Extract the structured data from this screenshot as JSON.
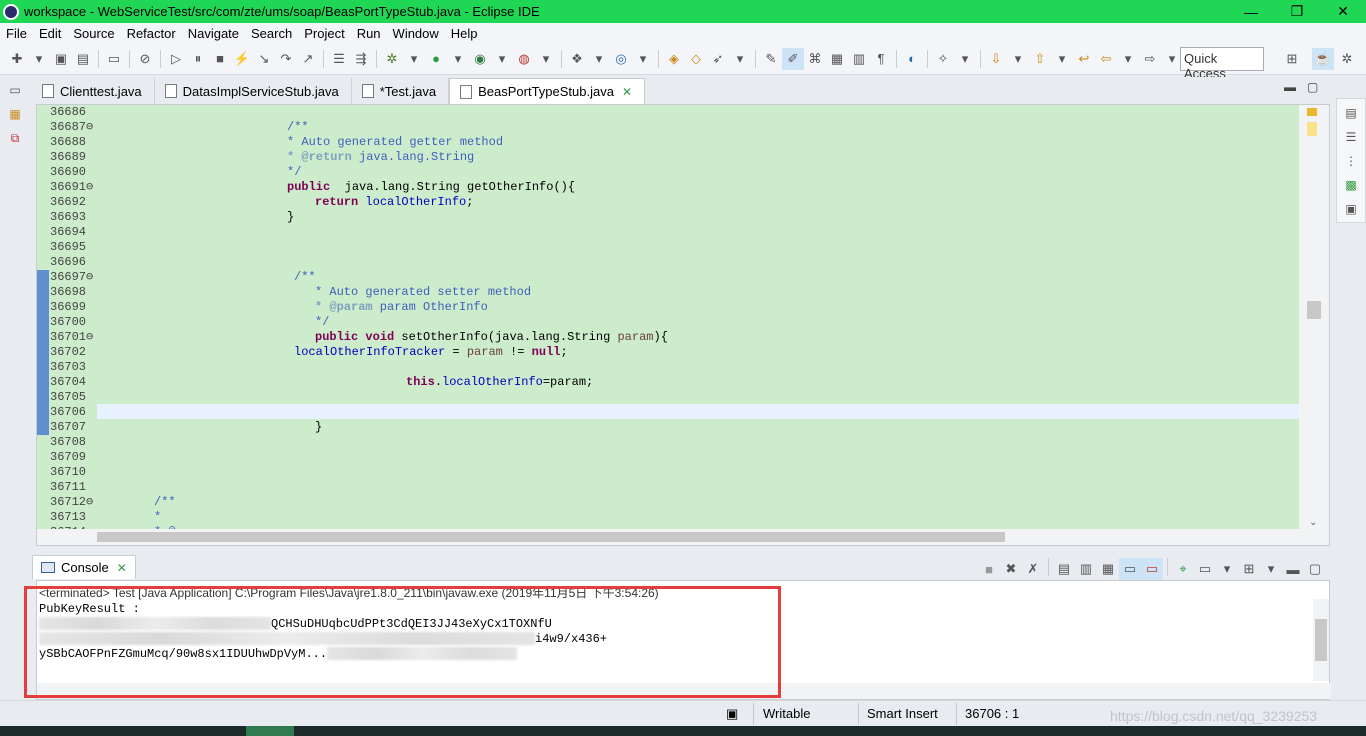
{
  "window": {
    "title": "workspace - WebServiceTest/src/com/zte/ums/soap/BeasPortTypeStub.java - Eclipse IDE",
    "minimize": "—",
    "maximize": "❐",
    "close": "✕"
  },
  "menu": {
    "items": [
      "File",
      "Edit",
      "Source",
      "Refactor",
      "Navigate",
      "Search",
      "Project",
      "Run",
      "Window",
      "Help"
    ]
  },
  "toolbar": {
    "quick_access": "Quick Access"
  },
  "editor": {
    "tabs": [
      {
        "label": "Clienttest.java"
      },
      {
        "label": "DatasImplServiceStub.java"
      },
      {
        "label": "*Test.java"
      },
      {
        "label": "BeasPortTypeStub.java"
      }
    ],
    "line_numbers": [
      "36686",
      "36687",
      "36688",
      "36689",
      "36690",
      "36691",
      "36692",
      "36693",
      "36694",
      "36695",
      "36696",
      "36697",
      "36698",
      "36699",
      "36700",
      "36701",
      "36702",
      "36703",
      "36704",
      "36705",
      "36706",
      "36707",
      "36708",
      "36709",
      "36710",
      "36711",
      "36712",
      "36713",
      "36714"
    ],
    "fold_markers": [
      "36687",
      "36691",
      "36697",
      "36701",
      "36712"
    ],
    "code": {
      "l36687": "/**",
      "l36688": "* Auto generated getter method",
      "l36689_tag": "* @return",
      "l36689_rest": " java.lang.String",
      "l36690": "*/",
      "l36691_kw": "public",
      "l36691_rest": "  java.lang.String getOtherInfo(){",
      "l36692_kw": "return",
      "l36692_field": "localOtherInfo",
      "l36692_end": ";",
      "l36693": "}",
      "l36697": "/**",
      "l36698": "* Auto generated setter method",
      "l36699_tag": "* @param",
      "l36699_rest": " param OtherInfo",
      "l36700": "*/",
      "l36701_kw1": "public",
      "l36701_kw2": "void",
      "l36701_rest": " setOtherInfo(java.lang.String ",
      "l36701_param": "param",
      "l36701_end": "){",
      "l36702_field": "localOtherInfoTracker",
      "l36702_mid": " = ",
      "l36702_param": "param",
      "l36702_op": " != ",
      "l36702_kw": "null",
      "l36702_end": ";",
      "l36704_kw": "this",
      "l36704_dot": ".",
      "l36704_field": "localOtherInfo",
      "l36704_eq": "=param;",
      "l36707": "}",
      "l36712": "/**",
      "l36713": "*",
      "l36714": "* @"
    }
  },
  "console": {
    "tab_label": "Console",
    "terminated": "<terminated> Test [Java Application] C:\\Program Files\\Java\\jre1.8.0_211\\bin\\javaw.exe (2019年11月5日 下午3:54:26)",
    "line1": "PubKeyResult :",
    "line2_visible": "QCHSuDHUqbcUdPPt3CdQEI3JJ43eXyCx1TOXNfU",
    "line3_visible": "i4w9/x436+",
    "line4_visible": "ySBbCAOFPnFZGmuMcq/90w8sx1IDUUhwDpVyM..."
  },
  "status": {
    "writable": "Writable",
    "insert_mode": "Smart Insert",
    "position": "36706 : 1"
  },
  "watermark": "https://blog.csdn.net/qq_3239253"
}
